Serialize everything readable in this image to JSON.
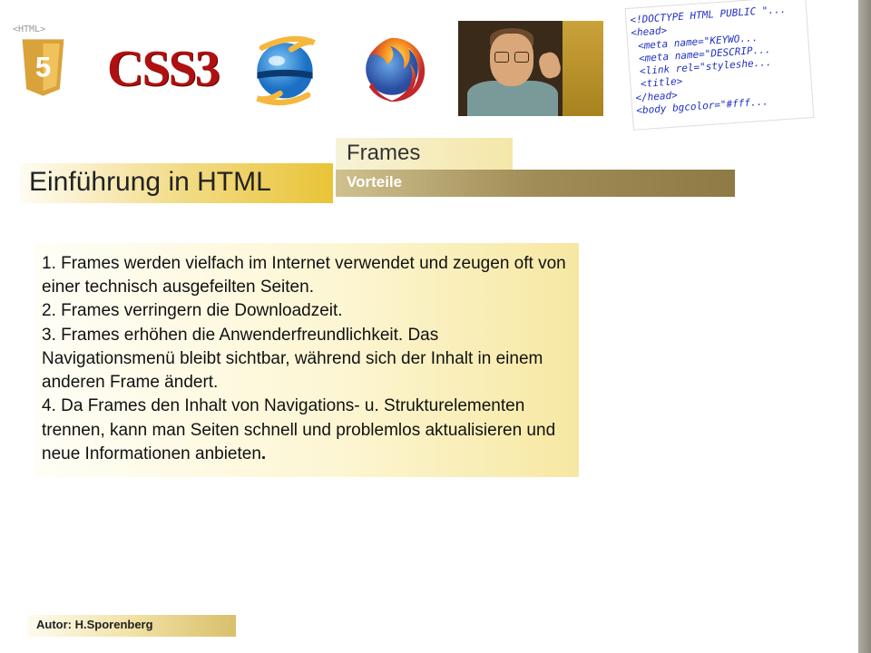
{
  "header": {
    "css3_label": "CSS3",
    "code_lines": "<!DOCTYPE HTML PUBLIC \"...\n<head>\n <meta name=\"KEYWO...\n <meta name=\"DESCRIP...\n <link rel=\"styleshe...\n <title>\n</head>\n<body bgcolor=\"#fff...\n"
  },
  "titles": {
    "main": "Einführung in HTML",
    "tab": "Frames",
    "sub": "Vorteile"
  },
  "body": {
    "p1": "1. Frames werden vielfach im Internet verwendet und zeugen oft von einer technisch ausgefeilten Seiten.",
    "p2": "2. Frames verringern die Downloadzeit.",
    "p3": "3. Frames erhöhen die Anwenderfreundlichkeit. Das Navigationsmenü bleibt sichtbar, während sich der Inhalt in einem anderen Frame ändert.",
    "p4a": "4. Da Frames den Inhalt von Navigations- u. Strukturelementen trennen, kann man Seiten schnell und problemlos aktualisieren und neue Informationen anbieten",
    "p4b": "."
  },
  "footer": {
    "author": "Autor: H.Sporenberg"
  }
}
